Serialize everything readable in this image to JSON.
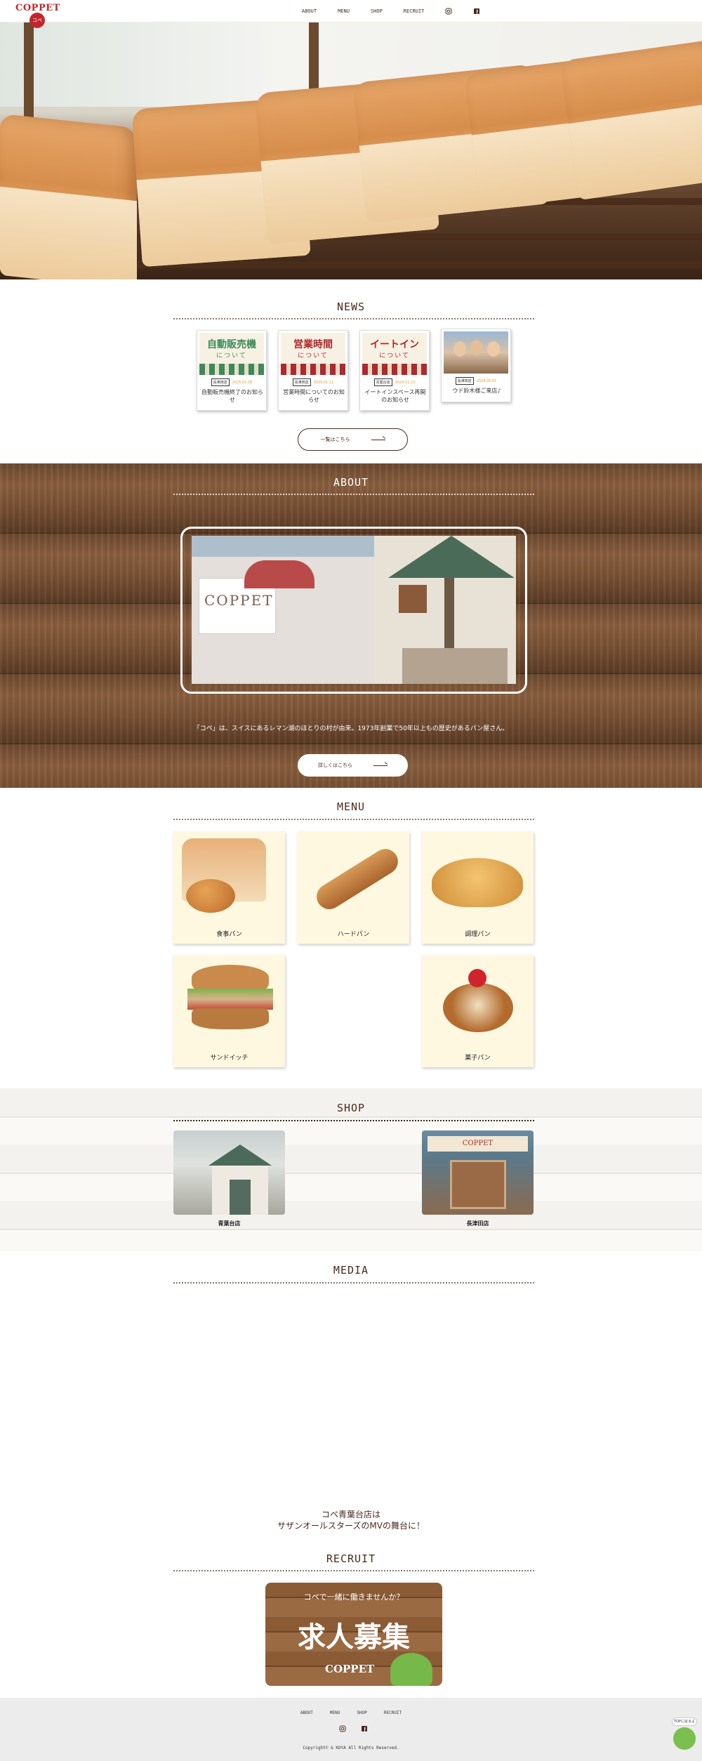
{
  "header": {
    "logo": "COPPET",
    "logo_badge": "コペ",
    "nav": [
      "ABOUT",
      "MENU",
      "SHOP",
      "RECRUIT"
    ],
    "icons": [
      "instagram-icon",
      "facebook-icon"
    ]
  },
  "news": {
    "title": "NEWS",
    "items": [
      {
        "thumb_line1": "自動販売機",
        "thumb_line2": "について",
        "tag": "長津田店",
        "date": "2025.01.28",
        "title": "自動販売機終了のお知らせ",
        "color": "#3c8a5a"
      },
      {
        "thumb_line1": "営業時間",
        "thumb_line2": "について",
        "tag": "長津田店",
        "date": "2025.01.11",
        "title": "営業時間についてのお知らせ",
        "color": "#b0282c"
      },
      {
        "thumb_line1": "イートイン",
        "thumb_line2": "について",
        "tag": "青葉台店",
        "date": "2024.11.13",
        "title": "イートインスペース再開のお知らせ",
        "color": "#b0282c"
      },
      {
        "thumb_line1": "",
        "thumb_line2": "",
        "tag": "長津田店",
        "date": "2024.05.01",
        "title": "ウド鈴木様ご来店♪",
        "color": "#6a4a8a"
      }
    ],
    "more_button": "一覧はこちら"
  },
  "about": {
    "title": "ABOUT",
    "text": "「コペ」は、スイスにあるレマン湖のほとりの村が由来。1973年創業で50年以上もの歴史があるパン屋さん。",
    "button": "詳しくはこちら"
  },
  "menu": {
    "title": "MENU",
    "items": [
      "食事パン",
      "ハードパン",
      "調理パン",
      "サンドイッチ",
      "菓子パン"
    ]
  },
  "shop": {
    "title": "SHOP",
    "items": [
      "青葉台店",
      "長津田店"
    ],
    "sign_text": "COPPET"
  },
  "media": {
    "title": "MEDIA",
    "line1": "コペ青葉台店は",
    "line2": "サザンオールスターズのMVの舞台に！"
  },
  "recruit": {
    "title": "RECRUIT",
    "banner_sub": "コペで一緒に働きませんか？",
    "banner_main": "求人募集",
    "banner_logo": "COPPET"
  },
  "footer": {
    "nav": [
      "ABOUT",
      "MENU",
      "SHOP",
      "RECRUIT"
    ],
    "copyright": "Copyright© & KOYA All Rights Reserved.",
    "top_button": "TOPに戻るよ"
  }
}
